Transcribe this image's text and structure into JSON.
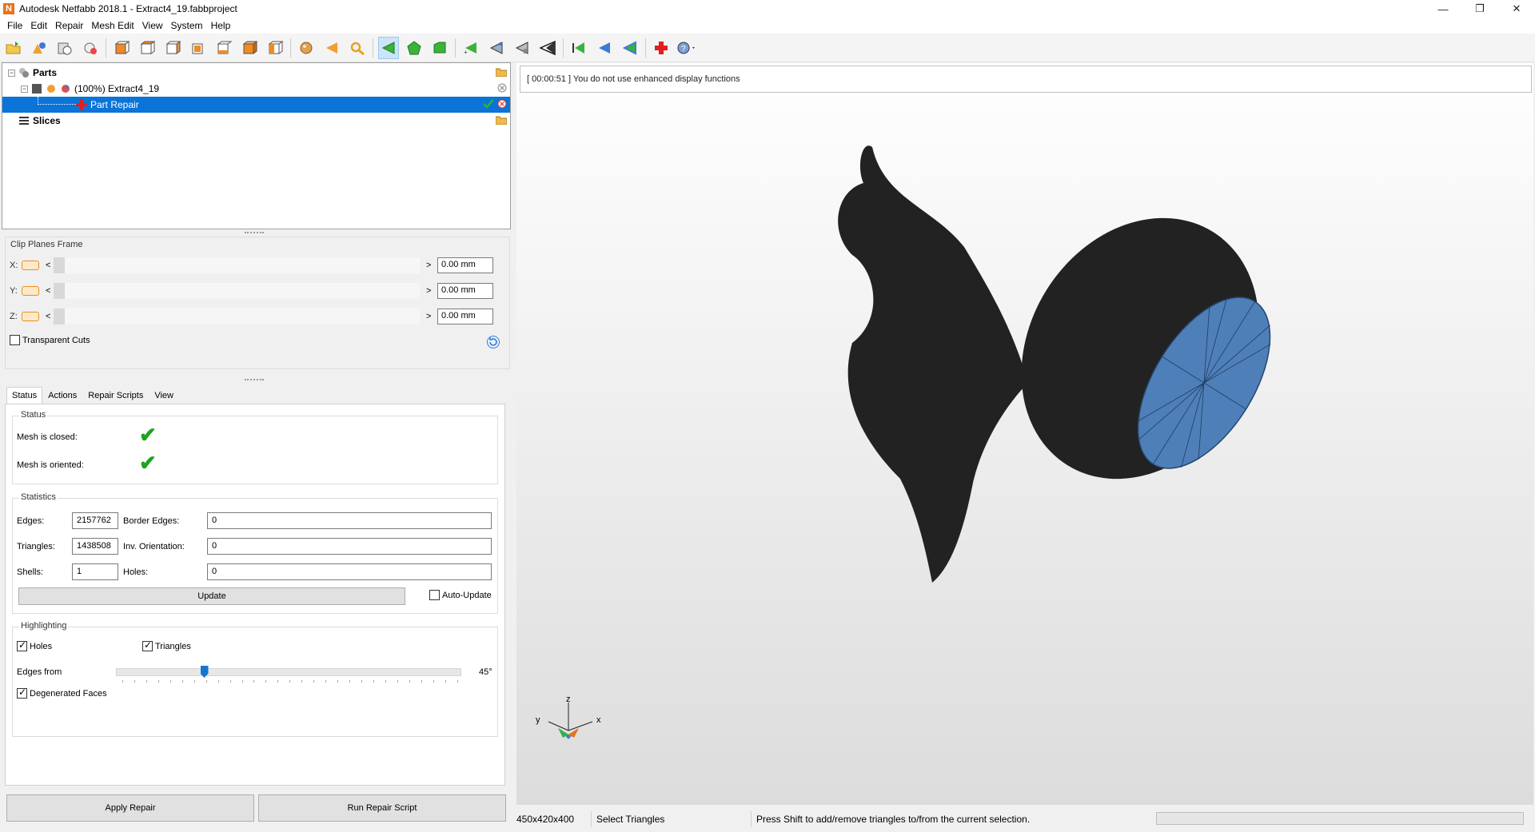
{
  "window": {
    "title": "Autodesk Netfabb 2018.1 - Extract4_19.fabbproject",
    "logo_letter": "N",
    "controls": [
      "—",
      "❐",
      "✕"
    ]
  },
  "menu": [
    "File",
    "Edit",
    "Repair",
    "Mesh Edit",
    "View",
    "System",
    "Help"
  ],
  "tree": {
    "parts_label": "Parts",
    "part_label": "(100%) Extract4_19",
    "repair_label": "Part Repair",
    "slices_label": "Slices"
  },
  "clip": {
    "title": "Clip Planes Frame",
    "axes": [
      {
        "label": "X:",
        "value": "0.00 mm"
      },
      {
        "label": "Y:",
        "value": "0.00 mm"
      },
      {
        "label": "Z:",
        "value": "0.00 mm"
      }
    ],
    "left_arrow": "<",
    "right_arrow": ">",
    "transparent_label": "Transparent Cuts",
    "transparent_checked": false
  },
  "tabs": [
    "Status",
    "Actions",
    "Repair Scripts",
    "View"
  ],
  "status": {
    "title": "Status",
    "closed_label": "Mesh is closed:",
    "oriented_label": "Mesh is oriented:",
    "check_glyph": "✔"
  },
  "statistics": {
    "title": "Statistics",
    "edges_label": "Edges:",
    "edges_value": "2157762",
    "triangles_label": "Triangles:",
    "triangles_value": "1438508",
    "shells_label": "Shells:",
    "shells_value": "1",
    "border_label": "Border Edges:",
    "border_value": "0",
    "inv_label": "Inv. Orientation:",
    "inv_value": "0",
    "holes_label": "Holes:",
    "holes_value": "0",
    "update_label": "Update",
    "auto_update_label": "Auto-Update",
    "auto_update_checked": false
  },
  "highlighting": {
    "title": "Highlighting",
    "holes_label": "Holes",
    "holes_checked": true,
    "triangles_label": "Triangles",
    "triangles_checked": true,
    "edges_from_label": "Edges from",
    "edges_from_value": "45°",
    "edges_from_fraction": 0.25,
    "degenerated_label": "Degenerated Faces",
    "degenerated_checked": true
  },
  "buttons": {
    "apply": "Apply Repair",
    "run_script": "Run Repair Script"
  },
  "viewport": {
    "info": "[ 00:00:51 ] You do not use enhanced display functions",
    "axis_x": "x",
    "axis_y": "y",
    "axis_z": "z",
    "mesh_color": "#222222",
    "hole_color": "#4f7fb8"
  },
  "statusbar": {
    "size": "450x420x400",
    "mode": "Select Triangles",
    "hint": "Press Shift to add/remove triangles to/from the current selection."
  }
}
